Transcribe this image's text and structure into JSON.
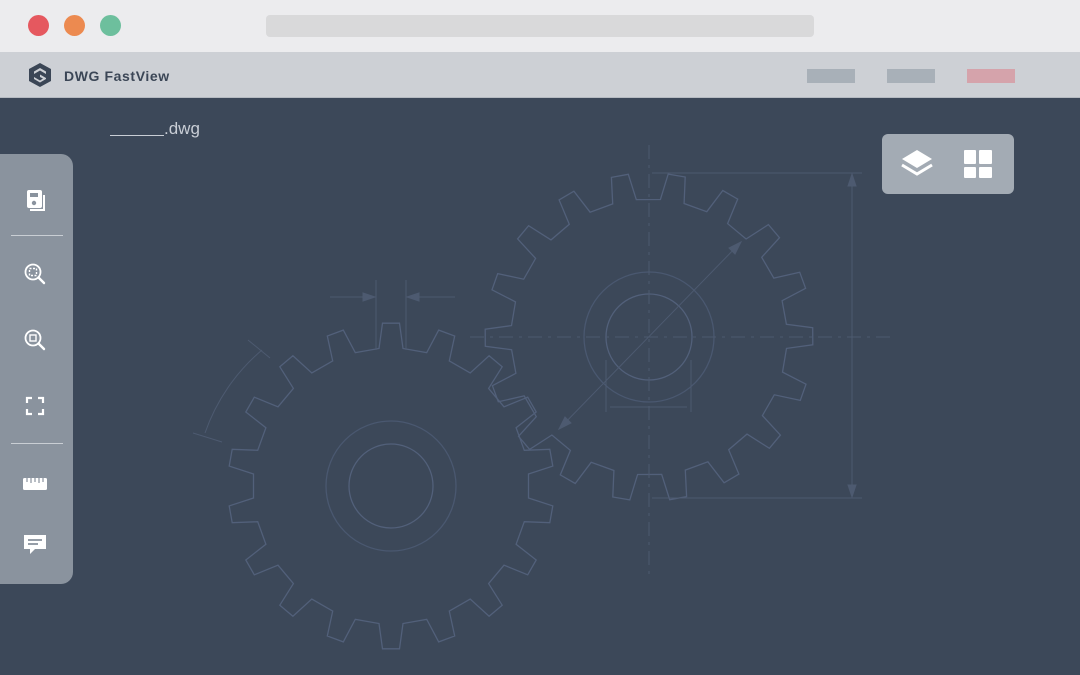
{
  "window": {
    "controls": {
      "close_color": "#e5585f",
      "minimize_color": "#ec8a50",
      "zoom_color": "#6dbf9d"
    }
  },
  "header": {
    "logo_icon": "dwg-fastview-logo-icon",
    "app_name": "DWG FastView",
    "buttons": [
      {
        "name": "header-button-1",
        "color": "#a8b0b8"
      },
      {
        "name": "header-button-2",
        "color": "#a8b0b8"
      },
      {
        "name": "header-button-3",
        "color": "#d5a3ab"
      }
    ]
  },
  "document": {
    "filename_suffix": ".dwg"
  },
  "toolbar": {
    "tools": [
      {
        "name": "save-tool",
        "icon": "save-icon"
      },
      {
        "name": "zoom-window-tool",
        "icon": "zoom-window-icon"
      },
      {
        "name": "zoom-extents-tool",
        "icon": "zoom-extents-icon"
      },
      {
        "name": "fullscreen-tool",
        "icon": "fullscreen-icon"
      },
      {
        "name": "measure-tool",
        "icon": "ruler-icon"
      },
      {
        "name": "comment-tool",
        "icon": "comment-icon"
      }
    ]
  },
  "right_panel": {
    "buttons": [
      {
        "name": "layers-button",
        "icon": "layers-icon"
      },
      {
        "name": "layouts-button",
        "icon": "layout-grid-icon"
      }
    ]
  }
}
